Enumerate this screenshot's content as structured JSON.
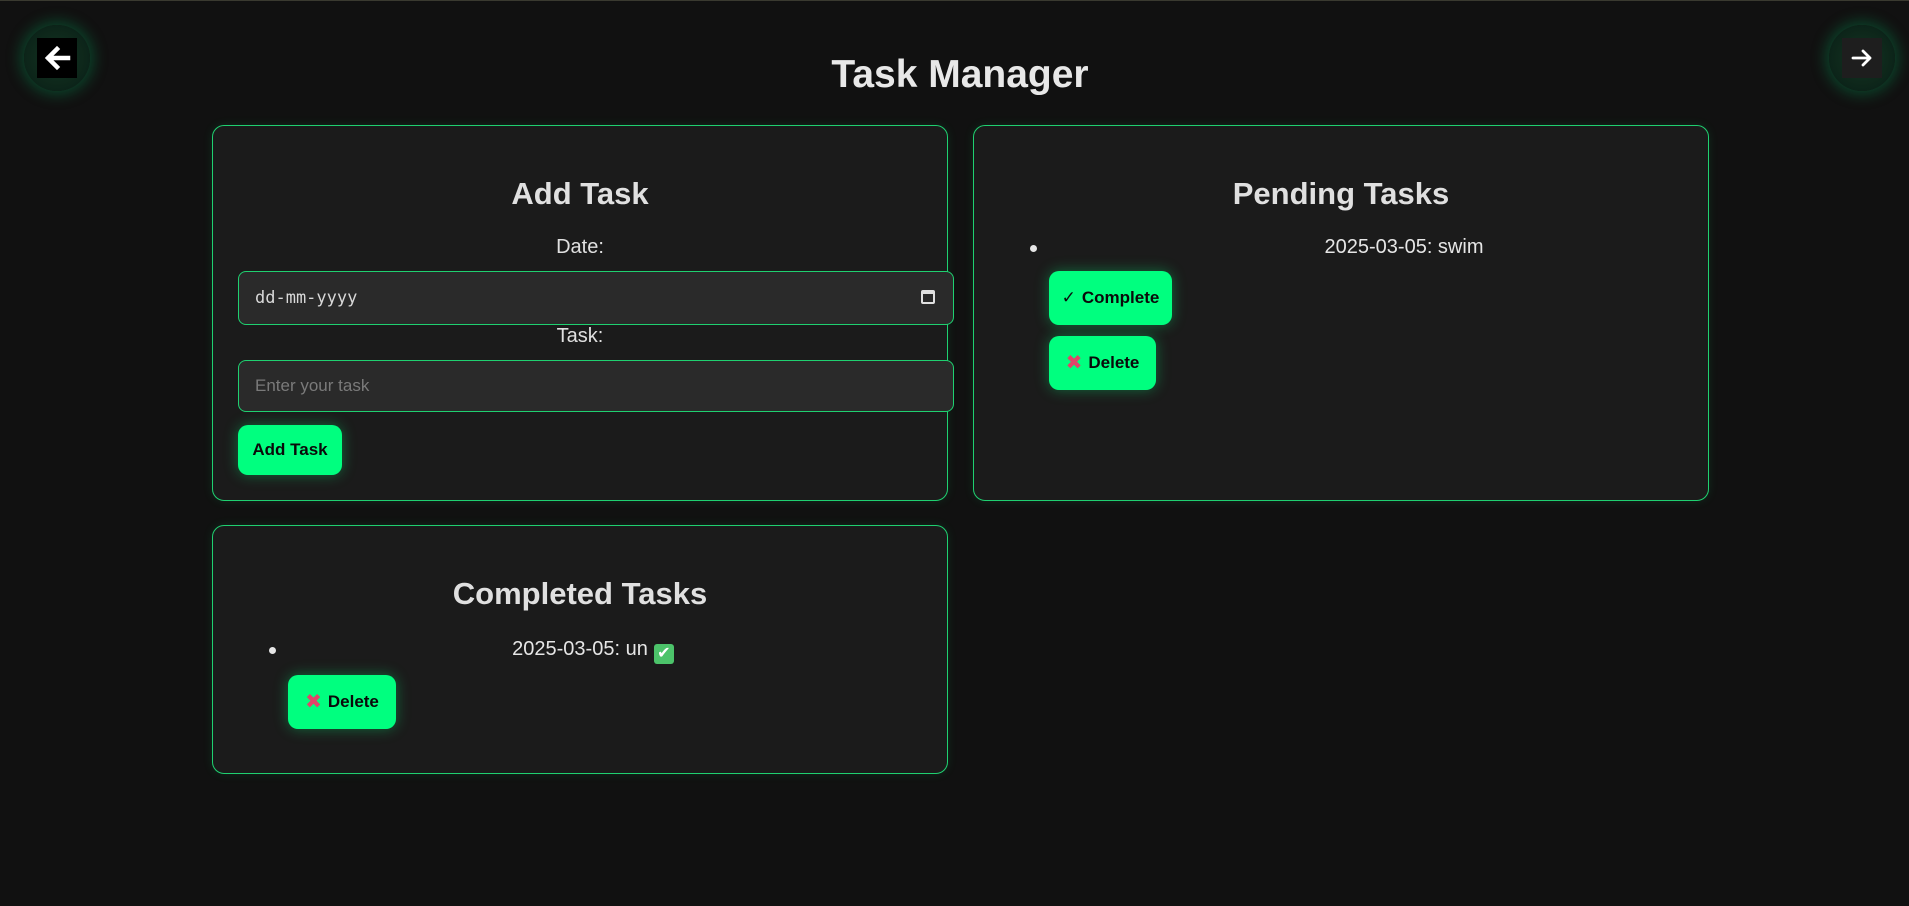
{
  "header": {
    "title": "Task Manager"
  },
  "nav": {
    "back_icon": "arrow-left-icon",
    "forward_icon": "arrow-right-icon"
  },
  "add_task": {
    "heading": "Add Task",
    "date_label": "Date:",
    "date_placeholder": "dd-mm-yyyy",
    "task_label": "Task:",
    "task_placeholder": "Enter your task",
    "submit_label": "Add Task"
  },
  "pending": {
    "heading": "Pending Tasks",
    "items": [
      {
        "text": "2025-03-05: swim",
        "complete_label": "Complete",
        "complete_icon": "✓",
        "delete_label": "Delete",
        "delete_icon": "✖"
      }
    ]
  },
  "completed": {
    "heading": "Completed Tasks",
    "items": [
      {
        "text": "2025-03-05: un",
        "status_icon": "✔",
        "delete_label": "Delete",
        "delete_icon": "✖"
      }
    ]
  },
  "colors": {
    "accent": "#00ff7f",
    "background": "#111111",
    "card": "#1b1b1b",
    "delete_icon": "#e0456a"
  }
}
